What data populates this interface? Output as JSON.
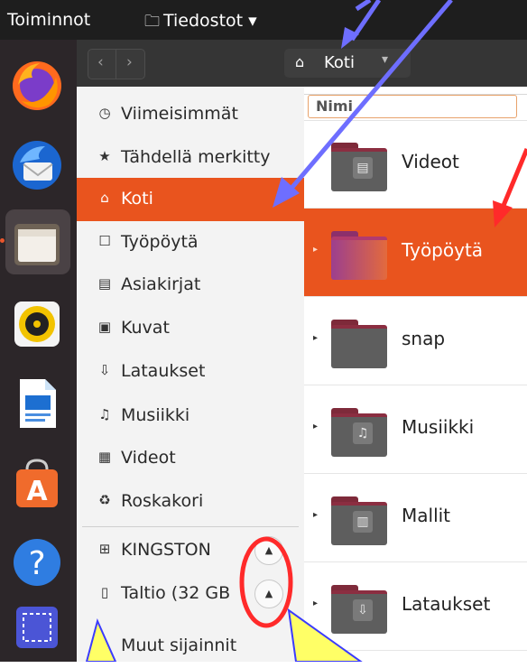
{
  "topbar": {
    "activities": "Toiminnot",
    "files_menu": "Tiedostot",
    "files_menu_arrow": "▾"
  },
  "header": {
    "back": "‹",
    "forward": "›",
    "path_label": "Koti",
    "path_caret": "▾"
  },
  "sidebar": {
    "items": [
      {
        "icon": "clock-icon",
        "glyph": "🕓",
        "label": "Viimeisimmät"
      },
      {
        "icon": "star-icon",
        "glyph": "★",
        "label": "Tähdellä merkitty"
      },
      {
        "icon": "home-icon",
        "glyph": "⌂",
        "label": "Koti"
      },
      {
        "icon": "desktop-icon",
        "glyph": "☐",
        "label": "Työpöytä"
      },
      {
        "icon": "document-icon",
        "glyph": "▤",
        "label": "Asiakirjat"
      },
      {
        "icon": "image-icon",
        "glyph": "▣",
        "label": "Kuvat"
      },
      {
        "icon": "download-icon",
        "glyph": "⇩",
        "label": "Lataukset"
      },
      {
        "icon": "music-icon",
        "glyph": "♫",
        "label": "Musiikki"
      },
      {
        "icon": "video-icon",
        "glyph": "▦",
        "label": "Videot"
      },
      {
        "icon": "trash-icon",
        "glyph": "♻",
        "label": "Roskakori"
      }
    ],
    "devices": [
      {
        "icon": "usb-icon",
        "glyph": "⊞",
        "label": "KINGSTON"
      },
      {
        "icon": "drive-icon",
        "glyph": "▯",
        "label": "Taltio (32 GB"
      }
    ],
    "other_locations": "Muut sijainnit",
    "eject_glyph": "▲"
  },
  "main": {
    "column_header": "Nimi",
    "rows": [
      {
        "name": "Videot",
        "emblem": "▤"
      },
      {
        "name": "Työpöytä",
        "emblem": ""
      },
      {
        "name": "snap",
        "emblem": ""
      },
      {
        "name": "Musiikki",
        "emblem": "♫"
      },
      {
        "name": "Mallit",
        "emblem": "▥"
      },
      {
        "name": "Lataukset",
        "emblem": "⇩"
      }
    ],
    "expander_glyph": "▸"
  },
  "colors": {
    "accent": "#e9541e",
    "annotation_blue": "#6e6eff",
    "annotation_yellow": "#ffff66",
    "annotation_red": "#ff2a2a"
  }
}
